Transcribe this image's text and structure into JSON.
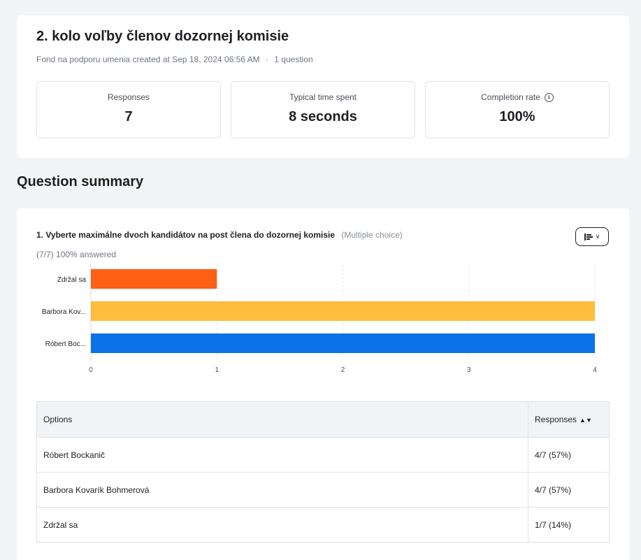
{
  "survey": {
    "title": "2. kolo voľby členov dozornej komisie",
    "owner": "Fond na podporu umenia",
    "created_label": "created at",
    "created_at": "Sep 18, 2024 06:56 AM",
    "separator": "·",
    "question_count": "1 question"
  },
  "stats": [
    {
      "label": "Responses",
      "value": "7"
    },
    {
      "label": "Typical time spent",
      "value": "8 seconds"
    },
    {
      "label": "Completion rate",
      "value": "100%",
      "info_icon": "info-icon"
    }
  ],
  "section_title": "Question summary",
  "question": {
    "number": "1.",
    "text": "Vyberte maximálne dvoch kandidátov na post člena do dozornej komisie",
    "type": "(Multiple choice)",
    "answered": "(7/7) 100% answered",
    "chart_toggle_icon": "bar-chart-icon"
  },
  "chart_data": {
    "type": "bar",
    "orientation": "horizontal",
    "categories": [
      "Zdržal sa",
      "Barbora Kov...",
      "Róbert Boc..."
    ],
    "values": [
      1,
      4,
      4
    ],
    "colors": [
      "#fd5f14",
      "#febd3c",
      "#0b72e7"
    ],
    "xticks": [
      "0",
      "1",
      "2",
      "3",
      "4"
    ],
    "xlim": [
      0,
      4
    ],
    "grid": true
  },
  "table": {
    "headers": {
      "options": "Options",
      "responses": "Responses"
    },
    "rows": [
      {
        "option": "Róbert Bockanič",
        "responses": "4/7 (57%)"
      },
      {
        "option": "Barbora Kovarík Bohmerová",
        "responses": "4/7 (57%)"
      },
      {
        "option": "Zdržal sa",
        "responses": "1/7 (14%)"
      }
    ]
  }
}
